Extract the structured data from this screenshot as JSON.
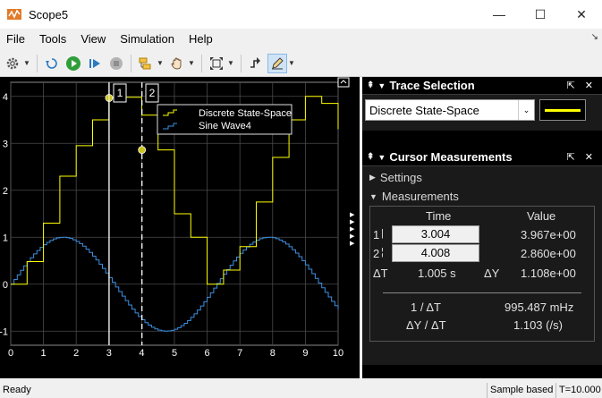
{
  "window": {
    "title": "Scope5",
    "minimize": "—",
    "maximize": "☐",
    "close": "✕"
  },
  "menu": [
    "File",
    "Tools",
    "View",
    "Simulation",
    "Help"
  ],
  "toolbar": {
    "icons": [
      "gear-icon",
      "step-back-icon",
      "run-icon",
      "step-forward-icon",
      "stop-icon",
      "highlight-icon",
      "pan-icon",
      "zoom-fit-icon",
      "cursor-icon",
      "edit-icon"
    ]
  },
  "plot": {
    "cursor1_label": "1",
    "cursor2_label": "2",
    "legend": [
      "Discrete State-Space",
      "Sine Wave4"
    ]
  },
  "chart_data": {
    "type": "line",
    "xlim": [
      0,
      10
    ],
    "ylim": [
      -1.3,
      4.3
    ],
    "x_ticks": [
      "0",
      "1",
      "2",
      "3",
      "4",
      "5",
      "6",
      "7",
      "8",
      "9",
      "10"
    ],
    "y_ticks": [
      "-1",
      "0",
      "1",
      "2",
      "3",
      "4"
    ],
    "grid": true,
    "legend_position": "top-center",
    "series": [
      {
        "name": "Discrete State-Space",
        "color": "#ffff00",
        "step": true,
        "x": [
          0,
          0.5,
          1,
          1.5,
          2,
          2.5,
          3,
          3.5,
          4,
          4.5,
          5,
          5.5,
          6,
          6.5,
          7,
          7.5,
          8,
          8.5,
          9,
          9.5,
          10
        ],
        "y": [
          0,
          0.48,
          1.3,
          2.3,
          2.95,
          3.5,
          3.97,
          3.98,
          3.6,
          2.86,
          1.5,
          1,
          0,
          0.3,
          0.8,
          1.75,
          2.7,
          3.5,
          4,
          3.85,
          3.3
        ]
      },
      {
        "name": "Sine Wave4",
        "color": "#3d8fe0",
        "step": true,
        "function": "sin(x)",
        "x_range": [
          0,
          10
        ],
        "sample_time": 0.1
      }
    ],
    "cursors": [
      {
        "label": "1",
        "x": 3.004,
        "y": 3.967,
        "style": "solid"
      },
      {
        "label": "2",
        "x": 4.008,
        "y": 2.86,
        "style": "dashed"
      }
    ]
  },
  "trace_selection": {
    "title": "Trace Selection",
    "selected": "Discrete State-Space",
    "line_color": "#ffff00"
  },
  "cursor_measurements": {
    "title": "Cursor Measurements",
    "settings_label": "Settings",
    "measurements_label": "Measurements",
    "col_time": "Time",
    "col_value": "Value",
    "rows": [
      {
        "label": "1",
        "time": "3.004",
        "value": "3.967e+00"
      },
      {
        "label": "2",
        "time": "4.008",
        "value": "2.860e+00"
      }
    ],
    "delta_t_label": "ΔT",
    "delta_t": "1.005 s",
    "delta_y_label": "ΔY",
    "delta_y": "1.108e+00",
    "inv_dt_label": "1 / ΔT",
    "inv_dt": "995.487 mHz",
    "dy_dt_label": "ΔY / ΔT",
    "dy_dt": "1.103 (/s)"
  },
  "status": {
    "ready": "Ready",
    "sample_mode": "Sample based",
    "time": "T=10.000"
  }
}
